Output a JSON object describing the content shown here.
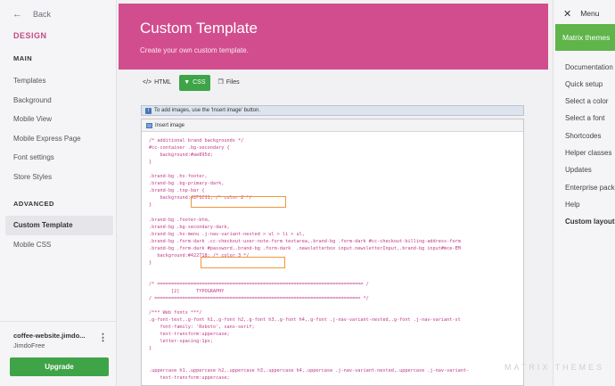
{
  "left_sidebar": {
    "back_label": "Back",
    "design_title": "DESIGN",
    "main_section": "MAIN",
    "main_items": [
      "Templates",
      "Background",
      "Mobile View",
      "Mobile Express Page",
      "Font settings",
      "Store Styles"
    ],
    "advanced_section": "ADVANCED",
    "advanced_items": [
      "Custom Template",
      "Mobile CSS"
    ],
    "active_item": "Custom Template",
    "account_name": "coffee-website.jimdo...",
    "account_plan": "JimdoFree",
    "upgrade_label": "Upgrade"
  },
  "header": {
    "title": "Custom Template",
    "subtitle": "Create your own custom template."
  },
  "tabs": [
    {
      "label": "HTML",
      "icon": "code-icon"
    },
    {
      "label": "CSS",
      "icon": "paint-roller-icon",
      "active": true
    },
    {
      "label": "Files",
      "icon": "files-icon"
    }
  ],
  "notice": "To add images, use the 'Insert image' button.",
  "editor": {
    "insert_image_label": "Insert image",
    "code_lines": [
      "/* additional brand backgrounds */",
      "#cc-container .bg-secondary {",
      "    background:#ae895d;",
      "}",
      "",
      ".brand-bg .hs-footer,",
      ".brand-bg .bg-primary-dark,",
      ".brand-bg .top-bar {",
      "    background:#2F1C11; /* color 2 */",
      "}",
      "",
      ".brand-bg .footer-btm,",
      ".brand-bg .bg-secondary-dark,",
      ".brand-bg .hs-menu .j-nav-variant-nested > ul > li > ul,",
      ".brand-bg .form-dark .cc-checkout-user-note-form textarea,.brand-bg .form-dark #cc-checkout-billing-address-form",
      ".brand-bg .form-dark #password,.brand-bg .form-dark  .newsletterbox input.newsletterInput,.brand-bg input#mce-EM",
      "   background:#422718; /* color 3 */",
      "}",
      "",
      "",
      "/* ========================================================================== /",
      "        [2]      TYPOGRAPHY",
      "/ ========================================================================== */",
      "",
      "/*** Web fonts ***/",
      ".g-font-text,.g-font h1,.g-font h2,.g-font h3,.g-font h4,.g-font .j-nav-variant-nested,.g-font .j-nav-variant-st",
      "    font-family: 'Roboto', sans-serif;",
      "    text-transform:uppercase;",
      "    letter-spacing:1px;",
      "}",
      "",
      "",
      ".uppercase h1,.uppercase h2,.uppercase h3,.uppercase h4,.uppercase .j-nav-variant-nested,.uppercase .j-nav-variant-",
      "    text-transform:uppercase;"
    ]
  },
  "right_sidebar": {
    "menu_label": "Menu",
    "brand_label": "Matrix themes",
    "items": [
      "Documentation",
      "Quick setup",
      "Select a color",
      "Select a font",
      "Shortcodes",
      "Helper classes",
      "Updates",
      "Enterprise package",
      "Help",
      "Custom layout"
    ],
    "active_item": "Custom layout"
  },
  "watermark": "MATRIX THEMES"
}
